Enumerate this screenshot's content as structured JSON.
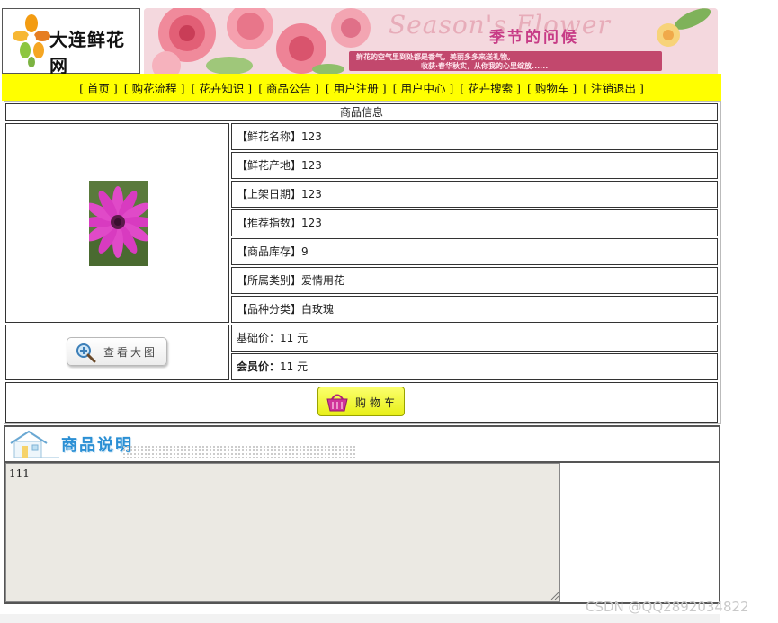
{
  "header": {
    "logo_text": "大连鲜花网",
    "banner_script": "Season's Flower",
    "banner_title": "季节的问候",
    "banner_line1": "鲜花的空气里到处都是香气，美丽多多来送礼物。",
    "banner_line2": "收获·春华秋实，从你我的心里绽放......"
  },
  "nav": [
    "[ 首页 ]",
    "[ 购花流程 ]",
    "[ 花卉知识 ]",
    "[ 商品公告 ]",
    "[ 用户注册 ]",
    "[ 用户中心 ]",
    "[ 花卉搜索 ]",
    "[ 购物车 ]",
    "[ 注销退出 ]"
  ],
  "product": {
    "header": "商品信息",
    "rows": [
      "【鲜花名称】123",
      "【鲜花产地】123",
      "【上架日期】123",
      "【推荐指数】123",
      "【商品库存】9",
      "【所属类别】爱情用花",
      "【品种分类】白玫瑰"
    ],
    "base_price_label": "基础价：",
    "base_price_value": "11 元",
    "member_price_label": "会员价：",
    "member_price_value": "11 元",
    "view_large_button": "查看大图",
    "cart_button": "购物车"
  },
  "description": {
    "title": "商品说明",
    "content": "111"
  },
  "watermark": "CSDN @QQ2892034822",
  "colors": {
    "nav_bg": "#ffff00",
    "cart_button_bg": "#eef02a",
    "desc_title": "#2b8fd4",
    "textarea_bg": "#ebe9e3"
  }
}
